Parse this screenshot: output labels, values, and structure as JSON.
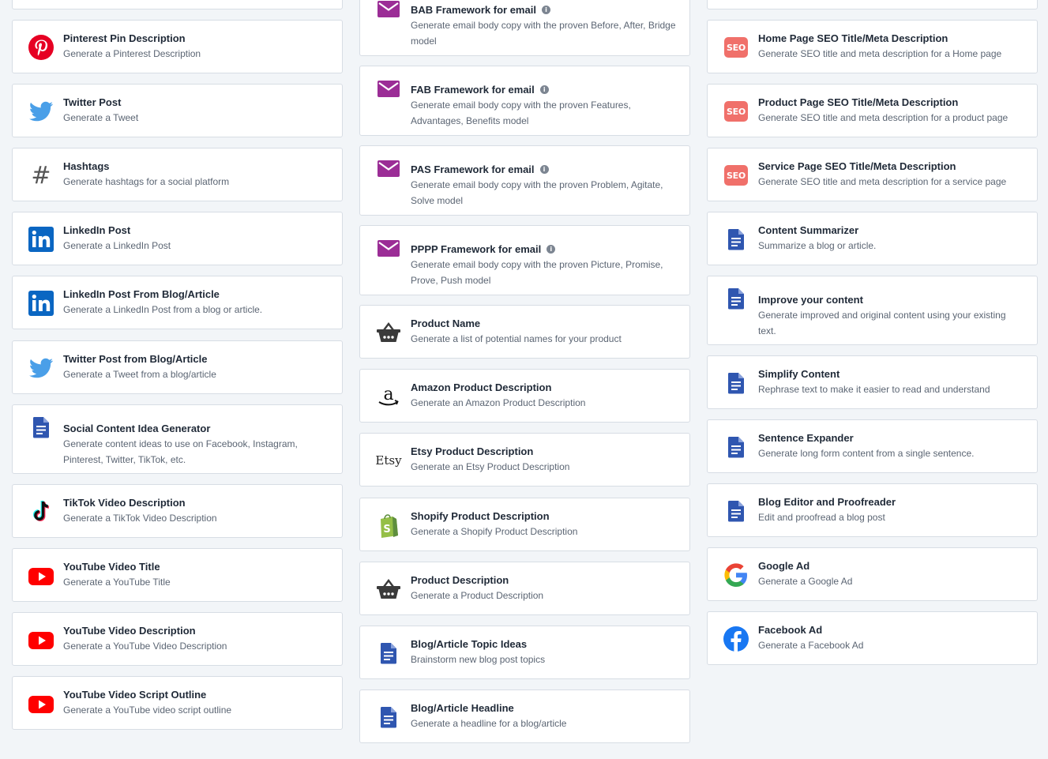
{
  "columns": [
    {
      "name": "left",
      "cards": [
        {
          "title": "",
          "desc": "",
          "icon": "blank"
        },
        {
          "title": "Pinterest Pin Description",
          "desc": "Generate a Pinterest Description",
          "icon": "pinterest-icon"
        },
        {
          "title": "Twitter Post",
          "desc": "Generate a Tweet",
          "icon": "twitter-icon"
        },
        {
          "title": "Hashtags",
          "desc": "Generate hashtags for a social platform",
          "icon": "hashtag-icon"
        },
        {
          "title": "LinkedIn Post",
          "desc": "Generate a LinkedIn Post",
          "icon": "linkedin-icon"
        },
        {
          "title": "LinkedIn Post From Blog/Article",
          "desc": "Generate a LinkedIn Post from a blog or article.",
          "icon": "linkedin-icon"
        },
        {
          "title": "Twitter Post from Blog/Article",
          "desc": "Generate a Tweet from a blog/article",
          "icon": "twitter-icon"
        },
        {
          "title": "Social Content Idea Generator",
          "desc": "Generate content ideas to use on Facebook, Instagram, Pinterest, Twitter, TikTok, etc.",
          "icon": "document-icon"
        },
        {
          "title": "TikTok Video Description",
          "desc": "Generate a TikTok Video Description",
          "icon": "tiktok-icon"
        },
        {
          "title": "YouTube Video Title",
          "desc": "Generate a YouTube Title",
          "icon": "youtube-icon"
        },
        {
          "title": "YouTube Video Description",
          "desc": "Generate a YouTube Video Description",
          "icon": "youtube-icon"
        },
        {
          "title": "YouTube Video Script Outline",
          "desc": "Generate a YouTube video script outline",
          "icon": "youtube-icon"
        }
      ]
    },
    {
      "name": "middle",
      "cards": [
        {
          "title": "BAB Framework for email",
          "desc": "Generate email body copy with the proven Before, After, Bridge model",
          "icon": "email-icon",
          "info": true
        },
        {
          "title": "FAB Framework for email",
          "desc": "Generate email body copy with the proven Features, Advantages, Benefits model",
          "icon": "email-icon",
          "info": true
        },
        {
          "title": "PAS Framework for email",
          "desc": "Generate email body copy with the proven Problem, Agitate, Solve model",
          "icon": "email-icon",
          "info": true
        },
        {
          "title": "PPPP Framework for email",
          "desc": "Generate email body copy with the proven Picture, Promise, Prove, Push model",
          "icon": "email-icon",
          "info": true
        },
        {
          "title": "Product Name",
          "desc": "Generate a list of potential names for your product",
          "icon": "basket-icon"
        },
        {
          "title": "Amazon Product Description",
          "desc": "Generate an Amazon Product Description",
          "icon": "amazon-icon"
        },
        {
          "title": "Etsy Product Description",
          "desc": "Generate an Etsy Product Description",
          "icon": "etsy-icon"
        },
        {
          "title": "Shopify Product Description",
          "desc": "Generate a Shopify Product Description",
          "icon": "shopify-icon"
        },
        {
          "title": "Product Description",
          "desc": "Generate a Product Description",
          "icon": "basket-icon"
        },
        {
          "title": "Blog/Article Topic Ideas",
          "desc": "Brainstorm new blog post topics",
          "icon": "document-icon"
        },
        {
          "title": "Blog/Article Headline",
          "desc": "Generate a headline for a blog/article",
          "icon": "document-icon"
        }
      ]
    },
    {
      "name": "right",
      "cards": [
        {
          "title": "",
          "desc": "",
          "icon": "blank"
        },
        {
          "title": "Home Page SEO Title/Meta Description",
          "desc": "Generate SEO title and meta description for a Home page",
          "icon": "seo-icon"
        },
        {
          "title": "Product Page SEO Title/Meta Description",
          "desc": "Generate SEO title and meta description for a product page",
          "icon": "seo-icon"
        },
        {
          "title": "Service Page SEO Title/Meta Description",
          "desc": "Generate SEO title and meta description for a service page",
          "icon": "seo-icon"
        },
        {
          "title": "Content Summarizer",
          "desc": "Summarize a blog or article.",
          "icon": "document-icon"
        },
        {
          "title": "Improve your content",
          "desc": "Generate improved and original content using your existing text.",
          "icon": "document-icon"
        },
        {
          "title": "Simplify Content",
          "desc": "Rephrase text to make it easier to read and understand",
          "icon": "document-icon"
        },
        {
          "title": "Sentence Expander",
          "desc": "Generate long form content from a single sentence.",
          "icon": "document-icon"
        },
        {
          "title": "Blog Editor and Proofreader",
          "desc": "Edit and proofread a blog post",
          "icon": "document-icon"
        },
        {
          "title": "Google Ad",
          "desc": "Generate a Google Ad",
          "icon": "google-icon"
        },
        {
          "title": "Facebook Ad",
          "desc": "Generate a Facebook Ad",
          "icon": "facebook-icon"
        }
      ]
    }
  ],
  "labels": {
    "seo_badge": "SEO",
    "etsy_logo": "Etsy",
    "info_glyph": "i",
    "hashtag_glyph": "#"
  },
  "colors": {
    "page_bg": "#f2f5f8",
    "card_border": "#d7dde4",
    "email": "#9b2d96",
    "document": "#2f56b0",
    "pinterest": "#e60023",
    "twitter": "#4a9fe8",
    "linkedin": "#0a66c2",
    "youtube": "#ff0000",
    "seo": "#f0706a",
    "facebook": "#1877f2",
    "shopify": "#95bf47"
  }
}
